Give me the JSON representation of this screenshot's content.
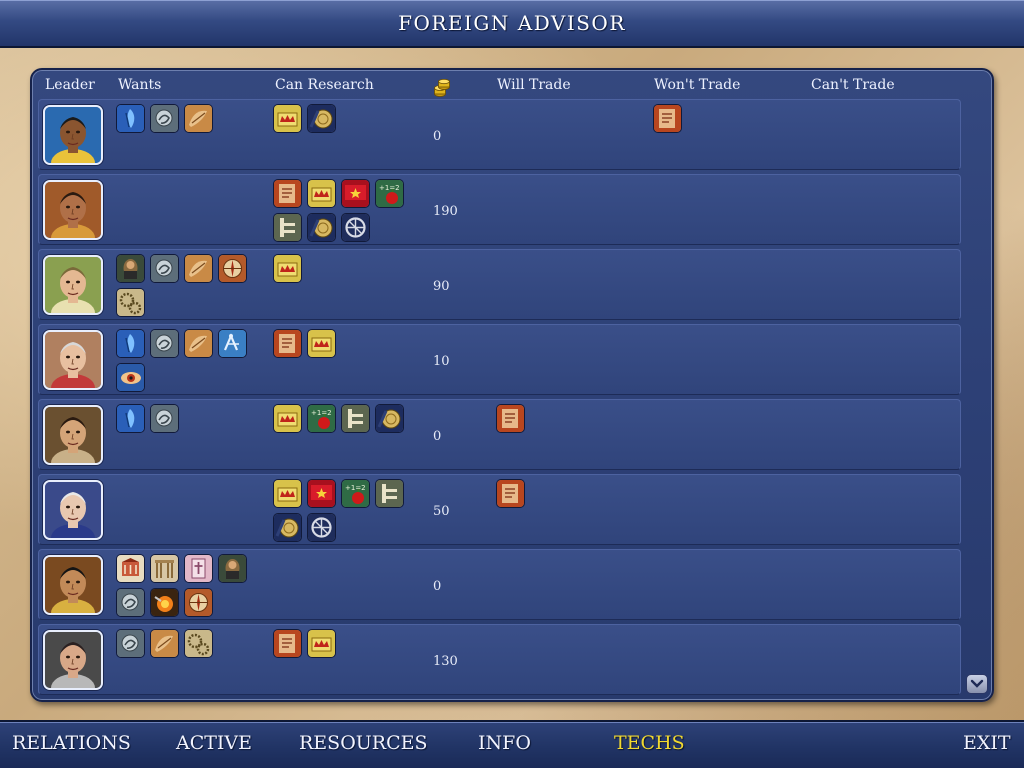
{
  "window": {
    "title": "FOREIGN ADVISOR"
  },
  "columns": {
    "leader": "Leader",
    "wants": "Wants",
    "can_research": "Can Research",
    "gold_icon": "gold-coin-icon",
    "will_trade": "Will Trade",
    "wont_trade": "Won't Trade",
    "cant_trade": "Can't Trade"
  },
  "rows": [
    {
      "leader": "leader-1",
      "wants": [
        "monotheism",
        "philosophy",
        "astronomy"
      ],
      "can_research": [
        "monarchy",
        "currency"
      ],
      "gold": "0",
      "will_trade": [],
      "wont_trade": [
        "writing"
      ]
    },
    {
      "leader": "leader-2",
      "wants": [],
      "can_research": [
        "writing",
        "monarchy",
        "flag",
        "mathematics",
        "construction",
        "currency",
        "wheel"
      ],
      "gold": "190",
      "will_trade": [],
      "wont_trade": []
    },
    {
      "leader": "leader-3",
      "wants": [
        "literature",
        "philosophy",
        "astronomy",
        "navigation",
        "engineering"
      ],
      "can_research": [
        "monarchy"
      ],
      "gold": "90",
      "will_trade": [],
      "wont_trade": []
    },
    {
      "leader": "leader-4",
      "wants": [
        "monotheism",
        "philosophy",
        "astronomy",
        "invention",
        "medicine"
      ],
      "can_research": [
        "writing",
        "monarchy"
      ],
      "gold": "10",
      "will_trade": [],
      "wont_trade": []
    },
    {
      "leader": "leader-5",
      "wants": [
        "monotheism",
        "philosophy"
      ],
      "can_research": [
        "monarchy",
        "mathematics",
        "construction",
        "currency"
      ],
      "gold": "0",
      "will_trade": [
        "writing"
      ],
      "wont_trade": []
    },
    {
      "leader": "leader-6",
      "wants": [],
      "can_research": [
        "monarchy",
        "flag",
        "mathematics",
        "construction",
        "currency",
        "wheel"
      ],
      "gold": "50",
      "will_trade": [
        "writing"
      ],
      "wont_trade": []
    },
    {
      "leader": "leader-7",
      "wants": [
        "banking",
        "architecture",
        "theology",
        "literature",
        "philosophy",
        "gunpowder",
        "navigation"
      ],
      "can_research": [],
      "gold": "0",
      "will_trade": [],
      "wont_trade": []
    },
    {
      "leader": "leader-8",
      "wants": [
        "philosophy",
        "astronomy",
        "engineering"
      ],
      "can_research": [
        "writing",
        "monarchy"
      ],
      "gold": "130",
      "will_trade": [],
      "wont_trade": []
    }
  ],
  "scroll": {
    "icon": "chevron-down-icon"
  },
  "nav": {
    "relations": "RELATIONS",
    "active": "ACTIVE",
    "resources": "RESOURCES",
    "info": "INFO",
    "techs": "TECHS",
    "exit": "EXIT"
  },
  "colors": {
    "panel": "#2d4076",
    "active_tab": "#f0d830",
    "parchment": "#d8bf98"
  }
}
